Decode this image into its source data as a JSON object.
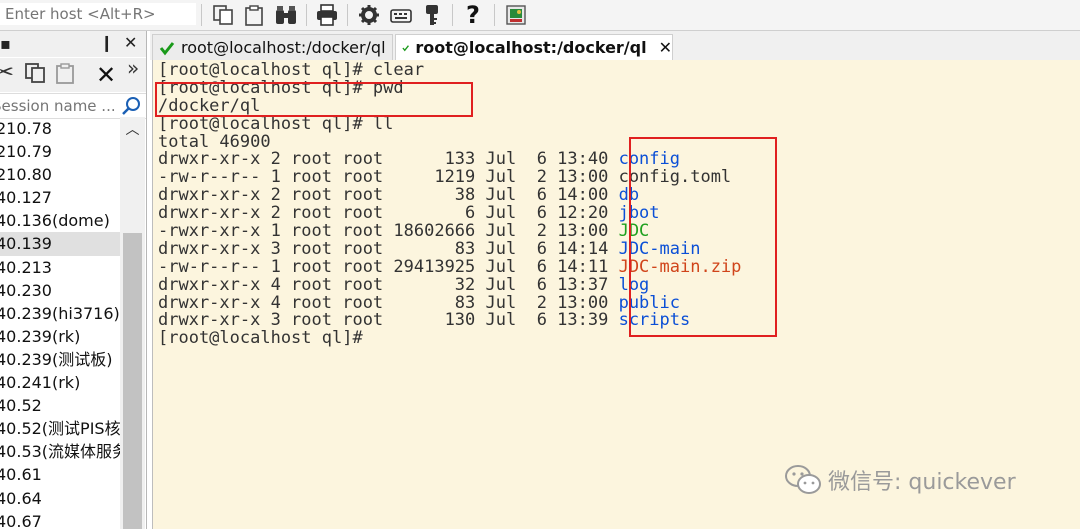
{
  "toolbar": {
    "host_placeholder": "Enter host <Alt+R>",
    "icons": [
      "copy-icon",
      "paste-icon",
      "find-icon",
      "print-icon",
      "settings-icon",
      "keyboard-icon",
      "key-icon",
      "help-icon",
      "screen-icon"
    ]
  },
  "left_panel": {
    "pin_glyph": "❙",
    "close_glyph": "✕",
    "more_glyph": "»",
    "search_placeholder": "Session name ...",
    "sessions": [
      "210.78",
      "210.79",
      "210.80",
      "40.127",
      "40.136(dome)",
      "40.139",
      "40.213",
      "40.230",
      "40.239(hi3716)",
      "40.239(rk)",
      "40.239(测试板)",
      "40.241(rk)",
      "40.52",
      "40.52(测试PIS核心",
      "40.53(流媒体服务",
      "40.61",
      "40.64",
      "40.67"
    ],
    "selected_index": 5
  },
  "tabs": [
    {
      "label": "root@localhost:/docker/ql",
      "active": false
    },
    {
      "label": "root@localhost:/docker/ql",
      "active": true
    }
  ],
  "terminal": {
    "lines": [
      {
        "text": "[root@localhost ql]# clear"
      },
      {
        "text": "[root@localhost ql]# pwd"
      },
      {
        "text": "/docker/ql"
      },
      {
        "text": "[root@localhost ql]# ll"
      },
      {
        "text": "total 46900"
      }
    ],
    "files": [
      {
        "perms": "drwxr-xr-x",
        "links": "2",
        "owner": "root",
        "group": "root",
        "size": "133",
        "month": "Jul",
        "day": "6",
        "time": "13:40",
        "name": "config",
        "kind": "blue"
      },
      {
        "perms": "-rw-r--r--",
        "links": "1",
        "owner": "root",
        "group": "root",
        "size": "1219",
        "month": "Jul",
        "day": "2",
        "time": "13:00",
        "name": "config.toml",
        "kind": "plain"
      },
      {
        "perms": "drwxr-xr-x",
        "links": "2",
        "owner": "root",
        "group": "root",
        "size": "38",
        "month": "Jul",
        "day": "6",
        "time": "14:00",
        "name": "db",
        "kind": "blue"
      },
      {
        "perms": "drwxr-xr-x",
        "links": "2",
        "owner": "root",
        "group": "root",
        "size": "6",
        "month": "Jul",
        "day": "6",
        "time": "12:20",
        "name": "jbot",
        "kind": "blue"
      },
      {
        "perms": "-rwxr-xr-x",
        "links": "1",
        "owner": "root",
        "group": "root",
        "size": "18602666",
        "month": "Jul",
        "day": "2",
        "time": "13:00",
        "name": "JDC",
        "kind": "green"
      },
      {
        "perms": "drwxr-xr-x",
        "links": "3",
        "owner": "root",
        "group": "root",
        "size": "83",
        "month": "Jul",
        "day": "6",
        "time": "14:14",
        "name": "JDC-main",
        "kind": "blue"
      },
      {
        "perms": "-rw-r--r--",
        "links": "1",
        "owner": "root",
        "group": "root",
        "size": "29413925",
        "month": "Jul",
        "day": "6",
        "time": "14:11",
        "name": "JDC-main.zip",
        "kind": "red"
      },
      {
        "perms": "drwxr-xr-x",
        "links": "4",
        "owner": "root",
        "group": "root",
        "size": "32",
        "month": "Jul",
        "day": "6",
        "time": "13:37",
        "name": "log",
        "kind": "blue"
      },
      {
        "perms": "drwxr-xr-x",
        "links": "4",
        "owner": "root",
        "group": "root",
        "size": "83",
        "month": "Jul",
        "day": "2",
        "time": "13:00",
        "name": "public",
        "kind": "blue"
      },
      {
        "perms": "drwxr-xr-x",
        "links": "3",
        "owner": "root",
        "group": "root",
        "size": "130",
        "month": "Jul",
        "day": "6",
        "time": "13:39",
        "name": "scripts",
        "kind": "blue"
      }
    ],
    "final_prompt": "[root@localhost ql]#",
    "colors": {
      "background": "#fcf5de",
      "text": "#333333",
      "blue": "#0b4fd6",
      "green": "#1fa01f",
      "red": "#d0441a",
      "highlight": "#e02020"
    }
  },
  "watermark": {
    "text": "微信号: quickever"
  }
}
